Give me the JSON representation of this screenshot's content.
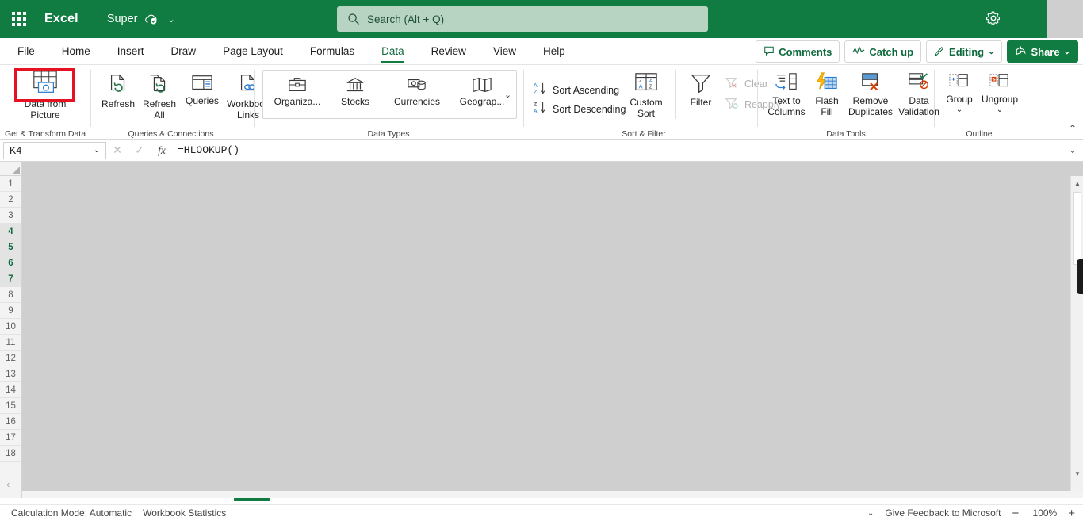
{
  "titlebar": {
    "app_name": "Excel",
    "document_name": "Super",
    "waffle_icon": "app-launcher-icon",
    "cloud_icon": "cloud-saved-icon",
    "chevron_icon": "chevron-down-icon",
    "gear_icon": "gear-icon"
  },
  "search": {
    "placeholder": "Search (Alt + Q)",
    "icon": "search-icon"
  },
  "ribbon_tabs": [
    {
      "label": "File",
      "active": false
    },
    {
      "label": "Home",
      "active": false
    },
    {
      "label": "Insert",
      "active": false
    },
    {
      "label": "Draw",
      "active": false
    },
    {
      "label": "Page Layout",
      "active": false
    },
    {
      "label": "Formulas",
      "active": false
    },
    {
      "label": "Data",
      "active": true
    },
    {
      "label": "Review",
      "active": false
    },
    {
      "label": "View",
      "active": false
    },
    {
      "label": "Help",
      "active": false
    }
  ],
  "tab_buttons": {
    "comments": "Comments",
    "catch_up": "Catch up",
    "editing": "Editing",
    "share": "Share"
  },
  "ribbon": {
    "groups": [
      {
        "name": "Get & Transform Data",
        "label": "Get & Transform Data"
      },
      {
        "name": "Queries & Connections",
        "label": "Queries & Connections"
      },
      {
        "name": "Data Types",
        "label": "Data Types"
      },
      {
        "name": "Sort & Filter",
        "label": "Sort & Filter"
      },
      {
        "name": "Data Tools",
        "label": "Data Tools"
      },
      {
        "name": "Outline",
        "label": "Outline"
      }
    ],
    "data_from_picture": {
      "line1": "Data from",
      "line2": "Picture",
      "highlighted": true
    },
    "refresh": "Refresh",
    "refresh_all_1": "Refresh",
    "refresh_all_2": "All",
    "queries": "Queries",
    "workbook_links_1": "Workbook",
    "workbook_links_2": "Links",
    "organization": "Organiza...",
    "stocks": "Stocks",
    "currencies": "Currencies",
    "geography": "Geograp...",
    "sort_ascending": "Sort Ascending",
    "sort_descending": "Sort Descending",
    "custom_sort_1": "Custom",
    "custom_sort_2": "Sort",
    "filter": "Filter",
    "clear": "Clear",
    "reapply": "Reapply",
    "text_to_columns_1": "Text to",
    "text_to_columns_2": "Columns",
    "flash_fill_1": "Flash",
    "flash_fill_2": "Fill",
    "remove_duplicates_1": "Remove",
    "remove_duplicates_2": "Duplicates",
    "data_validation_1": "Data",
    "data_validation_2": "Validation",
    "group": "Group",
    "ungroup": "Ungroup",
    "collapse_icon": "chevron-up-icon",
    "highlight_color": "#e81123"
  },
  "formula_bar": {
    "name_box_value": "K4",
    "cancel_icon": "cancel-icon",
    "enter_icon": "check-icon",
    "fx_label": "fx",
    "formula": "=HLOOKUP()",
    "expand_icon": "chevron-down-icon"
  },
  "sheet": {
    "rows": [
      {
        "num": "1",
        "selected": false
      },
      {
        "num": "2",
        "selected": false
      },
      {
        "num": "3",
        "selected": false
      },
      {
        "num": "4",
        "selected": true
      },
      {
        "num": "5",
        "selected": true
      },
      {
        "num": "6",
        "selected": true
      },
      {
        "num": "7",
        "selected": true
      },
      {
        "num": "8",
        "selected": false
      },
      {
        "num": "9",
        "selected": false
      },
      {
        "num": "10",
        "selected": false
      },
      {
        "num": "11",
        "selected": false
      },
      {
        "num": "12",
        "selected": false
      },
      {
        "num": "13",
        "selected": false
      },
      {
        "num": "14",
        "selected": false
      },
      {
        "num": "15",
        "selected": false
      },
      {
        "num": "16",
        "selected": false
      },
      {
        "num": "17",
        "selected": false
      },
      {
        "num": "18",
        "selected": false
      }
    ],
    "collapse_left_icon": "chevron-left-icon",
    "scroll_up_icon": "triangle-up-icon",
    "scroll_down_icon": "triangle-down-icon"
  },
  "status_bar": {
    "calculation_mode": "Calculation Mode: Automatic",
    "workbook_statistics": "Workbook Statistics",
    "feedback": "Give Feedback to Microsoft",
    "zoom_out_icon": "minus-icon",
    "zoom_level": "100%",
    "zoom_in_icon": "plus-icon",
    "options_chevron": "chevron-down-icon"
  },
  "colors": {
    "brand_green": "#107c41",
    "accent_green": "#0f6b3d",
    "highlight_red": "#e81123",
    "search_bg": "#b7d4c3"
  }
}
